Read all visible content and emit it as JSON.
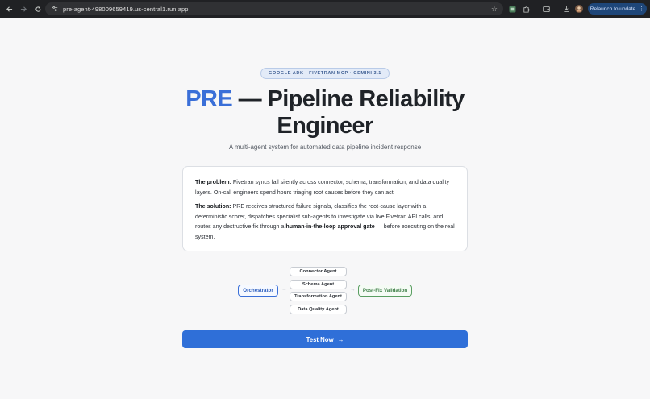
{
  "browser": {
    "url": "pre-agent-498009659419.us-central1.run.app",
    "relaunch_label": "Relaunch to update",
    "relaunch_icon": "more-vert-icon"
  },
  "hero": {
    "badge": "GOOGLE ADK · FIVETRAN MCP · GEMINI 3.1",
    "title_accent": "PRE",
    "title_rest": " — Pipeline Reliability Engineer",
    "subtitle": "A multi-agent system for automated data pipeline incident response",
    "accent_color": "#3a6fd8"
  },
  "card": {
    "problem_label": "The problem:",
    "problem_text": " Fivetran syncs fail silently across connector, schema, transformation, and data quality layers. On-call engineers spend hours triaging root causes before they can act.",
    "solution_label": "The solution:",
    "solution_text_1": " PRE receives structured failure signals, classifies the root-cause layer with a deterministic scorer, dispatches specialist sub-agents to investigate via live Fivetran API calls, and routes any destructive fix through a ",
    "solution_bold": "human-in-the-loop approval gate",
    "solution_text_2": " — before executing on the real system."
  },
  "diagram": {
    "orchestrator": "Orchestrator",
    "agents": [
      "Connector Agent",
      "Schema Agent",
      "Transformation Agent",
      "Data Quality Agent"
    ],
    "validation": "Post-Fix Validation",
    "arrow": "→"
  },
  "cta": {
    "label": "Test Now",
    "icon": "→",
    "color": "#2f6fd8"
  }
}
